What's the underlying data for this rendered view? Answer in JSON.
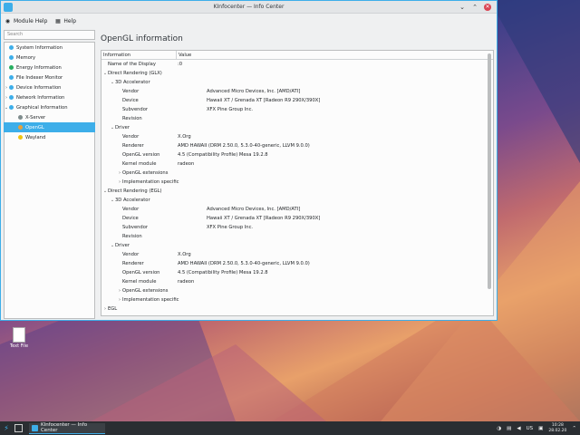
{
  "window": {
    "title": "KInfocenter — Info Center"
  },
  "toolbar": {
    "module_help": "Module Help",
    "help": "Help"
  },
  "sidebar": {
    "search_placeholder": "Search",
    "items": [
      {
        "label": "System Information",
        "color": "#3daee9",
        "arrow": ""
      },
      {
        "label": "Memory",
        "color": "#3daee9",
        "arrow": ""
      },
      {
        "label": "Energy Information",
        "color": "#27ae60",
        "arrow": ""
      },
      {
        "label": "File Indexer Monitor",
        "color": "#3daee9",
        "arrow": ""
      },
      {
        "label": "Device Information",
        "color": "#3daee9",
        "arrow": "›"
      },
      {
        "label": "Network Information",
        "color": "#3daee9",
        "arrow": "›"
      },
      {
        "label": "Graphical Information",
        "color": "#3daee9",
        "arrow": "⌄"
      },
      {
        "label": "X-Server",
        "color": "#7f8c8d",
        "arrow": ""
      },
      {
        "label": "OpenGL",
        "color": "#e8a03a",
        "arrow": ""
      },
      {
        "label": "Wayland",
        "color": "#f1c40f",
        "arrow": ""
      }
    ]
  },
  "main": {
    "title": "OpenGL information",
    "columns": [
      "Information",
      "Value"
    ],
    "rows": [
      {
        "indent": 0,
        "arrow": "",
        "key": "Name of the Display",
        "value": ":0",
        "vcol": 1
      },
      {
        "indent": 0,
        "arrow": "⌄",
        "key": "Direct Rendering (GLX)",
        "value": "",
        "vcol": 1
      },
      {
        "indent": 1,
        "arrow": "⌄",
        "key": "3D Accelerator",
        "value": "",
        "vcol": 1
      },
      {
        "indent": 2,
        "arrow": "",
        "key": "Vendor",
        "value": "Advanced Micro Devices, Inc. [AMD/ATI]",
        "vcol": 2
      },
      {
        "indent": 2,
        "arrow": "",
        "key": "Device",
        "value": "Hawaii XT / Grenada XT [Radeon R9 290X/390X]",
        "vcol": 2
      },
      {
        "indent": 2,
        "arrow": "",
        "key": "Subvendor",
        "value": "XFX Pine Group Inc.",
        "vcol": 2
      },
      {
        "indent": 2,
        "arrow": "",
        "key": "Revision",
        "value": "",
        "vcol": 2
      },
      {
        "indent": 1,
        "arrow": "⌄",
        "key": "Driver",
        "value": "",
        "vcol": 1
      },
      {
        "indent": 2,
        "arrow": "",
        "key": "Vendor",
        "value": "X.Org",
        "vcol": 1
      },
      {
        "indent": 2,
        "arrow": "",
        "key": "Renderer",
        "value": "AMD HAWAII (DRM 2.50.0, 5.3.0-40-generic, LLVM 9.0.0)",
        "vcol": 1
      },
      {
        "indent": 2,
        "arrow": "",
        "key": "OpenGL version",
        "value": "4.5 (Compatibility Profile) Mesa 19.2.8",
        "vcol": 1
      },
      {
        "indent": 2,
        "arrow": "",
        "key": "Kernel module",
        "value": "radeon",
        "vcol": 1
      },
      {
        "indent": 2,
        "arrow": "›",
        "key": "OpenGL extensions",
        "value": "",
        "vcol": 1
      },
      {
        "indent": 2,
        "arrow": "›",
        "key": "Implementation specific",
        "value": "",
        "vcol": 1
      },
      {
        "indent": 0,
        "arrow": "⌄",
        "key": "Direct Rendering (EGL)",
        "value": "",
        "vcol": 1
      },
      {
        "indent": 1,
        "arrow": "⌄",
        "key": "3D Accelerator",
        "value": "",
        "vcol": 1
      },
      {
        "indent": 2,
        "arrow": "",
        "key": "Vendor",
        "value": "Advanced Micro Devices, Inc. [AMD/ATI]",
        "vcol": 2
      },
      {
        "indent": 2,
        "arrow": "",
        "key": "Device",
        "value": "Hawaii XT / Grenada XT [Radeon R9 290X/390X]",
        "vcol": 2
      },
      {
        "indent": 2,
        "arrow": "",
        "key": "Subvendor",
        "value": "XFX Pine Group Inc.",
        "vcol": 2
      },
      {
        "indent": 2,
        "arrow": "",
        "key": "Revision",
        "value": "",
        "vcol": 2
      },
      {
        "indent": 1,
        "arrow": "⌄",
        "key": "Driver",
        "value": "",
        "vcol": 1
      },
      {
        "indent": 2,
        "arrow": "",
        "key": "Vendor",
        "value": "X.Org",
        "vcol": 1
      },
      {
        "indent": 2,
        "arrow": "",
        "key": "Renderer",
        "value": "AMD HAWAII (DRM 2.50.0, 5.3.0-40-generic, LLVM 9.0.0)",
        "vcol": 1
      },
      {
        "indent": 2,
        "arrow": "",
        "key": "OpenGL version",
        "value": "4.5 (Compatibility Profile) Mesa 19.2.8",
        "vcol": 1
      },
      {
        "indent": 2,
        "arrow": "",
        "key": "Kernel module",
        "value": "radeon",
        "vcol": 1
      },
      {
        "indent": 2,
        "arrow": "›",
        "key": "OpenGL extensions",
        "value": "",
        "vcol": 1
      },
      {
        "indent": 2,
        "arrow": "›",
        "key": "Implementation specific",
        "value": "",
        "vcol": 1
      },
      {
        "indent": 0,
        "arrow": "›",
        "key": "EGL",
        "value": "",
        "vcol": 1
      }
    ]
  },
  "desktop": {
    "file_label": "Text File"
  },
  "taskbar": {
    "task_label": "KInfocenter — Info Center",
    "keyboard_layout": "US",
    "time": "10:28",
    "date": "28.02.20"
  }
}
